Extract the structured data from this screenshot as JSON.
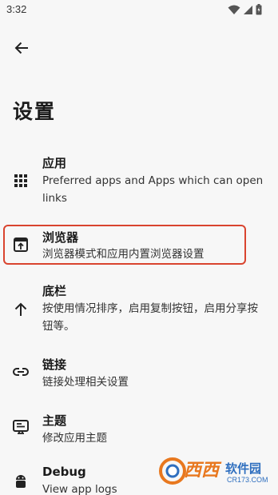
{
  "status_bar": {
    "time": "3:32"
  },
  "header": {
    "title": "设置"
  },
  "items": [
    {
      "title": "应用",
      "subtitle": "Preferred apps and Apps which can open links",
      "icon": "apps-grid-icon"
    },
    {
      "title": "浏览器",
      "subtitle": "浏览器模式和应用内置浏览器设置",
      "icon": "browser-window-icon"
    },
    {
      "title": "底栏",
      "subtitle": "按使用情况排序，启用复制按钮，启用分享按钮等。",
      "icon": "arrow-up-icon"
    },
    {
      "title": "链接",
      "subtitle": "链接处理相关设置",
      "icon": "link-icon"
    },
    {
      "title": "主题",
      "subtitle": "修改应用主题",
      "icon": "theme-icon"
    },
    {
      "title": "Debug",
      "subtitle": "View app logs",
      "icon": "android-bug-icon"
    }
  ],
  "watermark": {
    "title": "西西",
    "brand": "软件园",
    "url": "CR173.COM"
  },
  "colors": {
    "highlight": "#d9442f",
    "background": "#f7f7f7"
  }
}
